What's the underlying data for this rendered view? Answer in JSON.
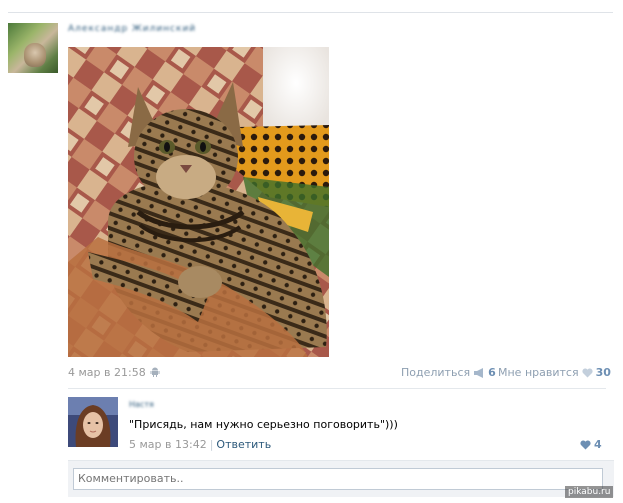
{
  "post": {
    "author": "Александр Жилинский",
    "date": "4 мар в 21:58",
    "device_icon": "android-icon",
    "share_label": "Поделиться",
    "share_count": "6",
    "like_label": "Мне нравится",
    "like_count": "30"
  },
  "comment": {
    "author": "Настя",
    "text": "\"Присядь, нам нужно серьезно поговорить\")))",
    "date": "5 мар в 13:42",
    "separator": "|",
    "reply_label": "Ответить",
    "like_count": "4"
  },
  "comment_form": {
    "placeholder": "Комментировать.."
  },
  "watermark": "pikabu.ru",
  "colors": {
    "link": "#2b587a",
    "meta": "#999999",
    "accent": "#6d8fb3"
  }
}
